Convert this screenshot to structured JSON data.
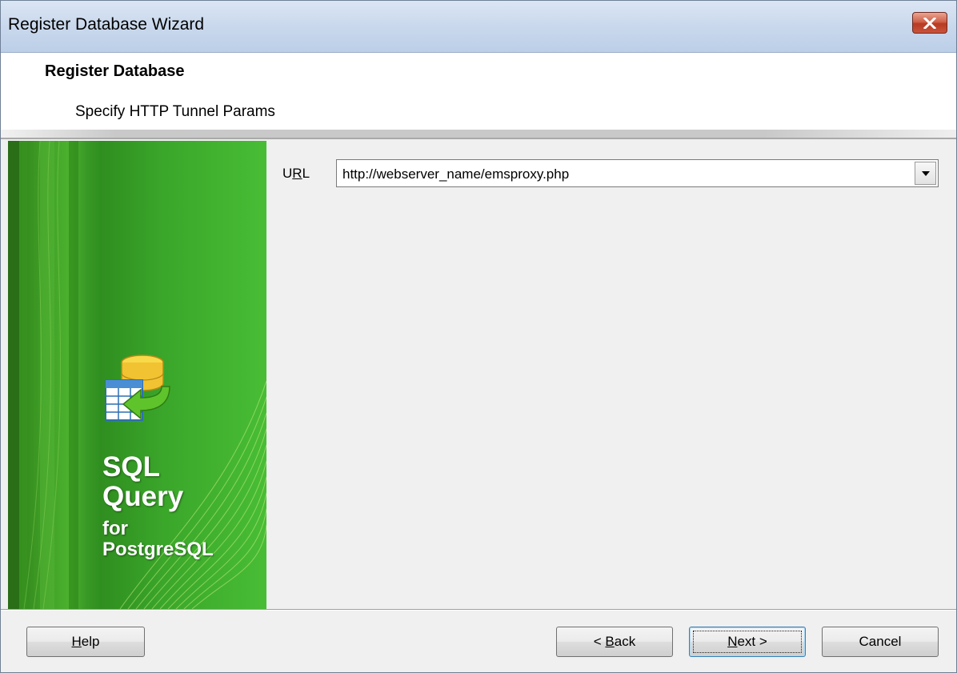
{
  "window": {
    "title": "Register Database Wizard",
    "close_icon": "close-icon"
  },
  "header": {
    "title": "Register Database",
    "subtitle": "Specify HTTP Tunnel Params"
  },
  "banner": {
    "logo_icon": "database-import-icon",
    "line1": "SQL",
    "line2": "Query",
    "line3": "for",
    "line4": "PostgreSQL"
  },
  "form": {
    "url_label_pre": "U",
    "url_label_acc": "R",
    "url_label_post": "L",
    "url_value": "http://webserver_name/emsproxy.php"
  },
  "buttons": {
    "help_acc": "H",
    "help_rest": "elp",
    "back_pre": "< ",
    "back_acc": "B",
    "back_rest": "ack",
    "next_acc": "N",
    "next_rest": "ext >",
    "cancel": "Cancel"
  },
  "colors": {
    "banner_green": "#3aa62a",
    "title_bar": "#c9d8ec",
    "close_red": "#c9543c"
  }
}
